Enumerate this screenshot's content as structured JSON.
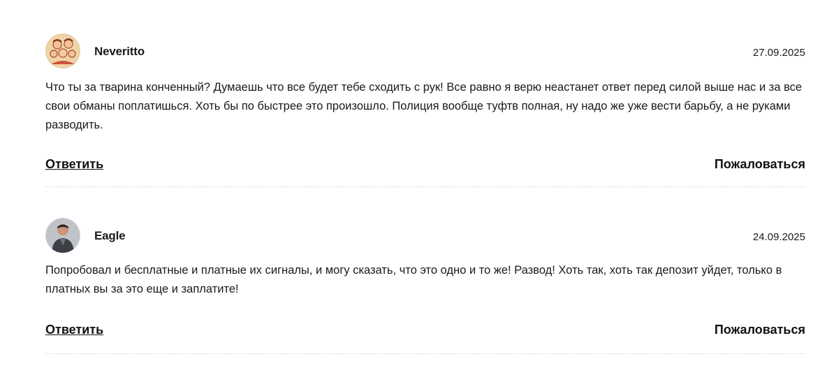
{
  "comments": [
    {
      "author": "Neveritto",
      "date": "27.09.2025",
      "avatar_icon": "family-drawing-avatar",
      "text": "Что ты за тварина конченный? Думаешь что все будет тебе сходить с рук! Все равно я верю неастанет ответ перед силой выше нас и за все свои обманы поплатишься. Хоть бы по быстрее это произошло. Полиция вообще туфтв полная, ну надо же уже вести барьбу, а не руками разводить.",
      "reply_label": "Ответить",
      "report_label": "Пожаловаться"
    },
    {
      "author": "Eagle",
      "date": "24.09.2025",
      "avatar_icon": "person-photo-avatar",
      "text": "Попробовал и бесплатные и платные их сигналы, и могу сказать, что это одно и то же! Развод! Хоть так, хоть так депозит уйдет, только в платных вы за это еще и заплатите!",
      "reply_label": "Ответить",
      "report_label": "Пожаловаться"
    }
  ]
}
